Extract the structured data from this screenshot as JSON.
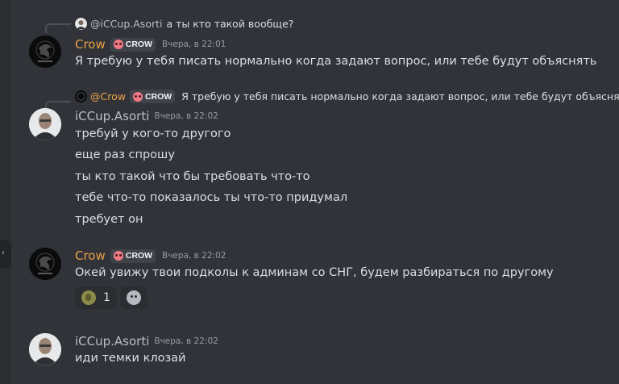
{
  "users": {
    "crow": {
      "name": "Crow",
      "role": "CROW",
      "color": "#e9a147"
    },
    "asorti": {
      "name": "iCCup.Asorti",
      "color": "#b8bec9"
    }
  },
  "messages": [
    {
      "reply": {
        "author": "@iCCup.Asorti",
        "text": "а ты кто такой вообще?"
      },
      "author": "Crow",
      "role": "CROW",
      "time": "Вчера, в 22:01",
      "lines": [
        "Я требую у тебя писать нормально когда задают вопрос, или тебе будут объяснять"
      ]
    },
    {
      "reply": {
        "author": "@Crow",
        "role": "CROW",
        "text": "Я требую у тебя писать нормально когда задают вопрос, или тебе будут объяснять"
      },
      "author": "iCCup.Asorti",
      "time": "Вчера, в 22:02",
      "lines": [
        "требуй у кого-то другого",
        "еще раз спрошу",
        "ты кто такой что бы требовать что-то",
        "тебе что-то показалось ты что-то придумал",
        "требует он"
      ]
    },
    {
      "author": "Crow",
      "role": "CROW",
      "time": "Вчера, в 22:02",
      "lines": [
        "Окей увижу твои подколы к админам со СНГ, будем разбираться по другому"
      ],
      "reactions": [
        {
          "emoji": "pepe-emoji",
          "count": "1"
        }
      ]
    },
    {
      "author": "iCCup.Asorti",
      "time": "Вчера, в 22:02",
      "lines": [
        "иди темки клозай"
      ]
    }
  ]
}
